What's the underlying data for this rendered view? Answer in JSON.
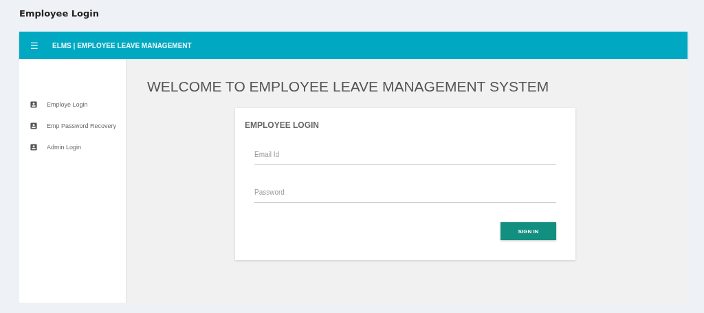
{
  "page_title": "Employee Login",
  "header": {
    "menu_glyph": "☰",
    "title": "ELMS | EMPLOYEE LEAVE MANAGEMENT"
  },
  "sidebar": {
    "items": [
      {
        "label": "Employe Login"
      },
      {
        "label": "Emp Password Recovery"
      },
      {
        "label": "Admin Login"
      }
    ]
  },
  "main": {
    "heading": "WELCOME TO EMPLOYEE LEAVE MANAGEMENT SYSTEM",
    "login_card": {
      "title": "EMPLOYEE LOGIN",
      "fields": [
        {
          "placeholder": "Email Id"
        },
        {
          "placeholder": "Password"
        }
      ],
      "button": "SIGN IN"
    }
  }
}
